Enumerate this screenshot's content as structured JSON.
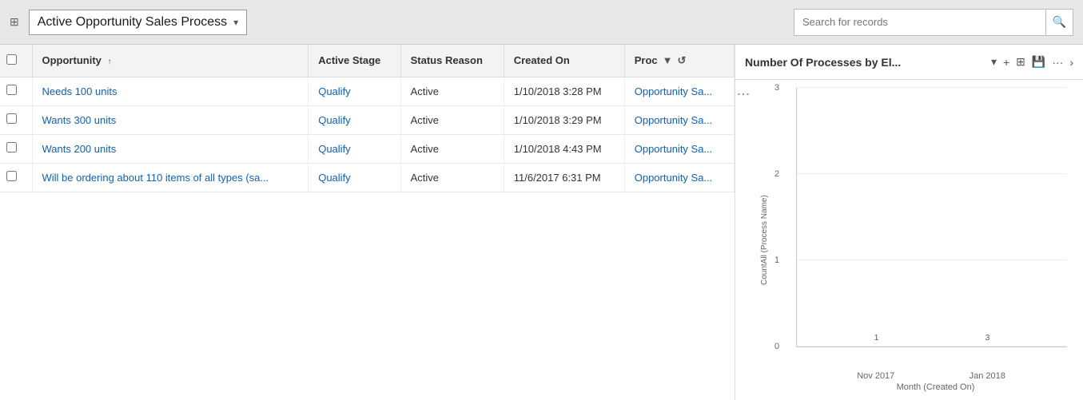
{
  "header": {
    "nav_icon": "⊞",
    "title": "Active Opportunity Sales Process",
    "chevron": "▾",
    "search_placeholder": "Search for records",
    "search_icon": "🔍"
  },
  "table": {
    "columns": [
      {
        "id": "checkbox",
        "label": ""
      },
      {
        "id": "opportunity",
        "label": "Opportunity",
        "sort": "↑"
      },
      {
        "id": "active_stage",
        "label": "Active Stage"
      },
      {
        "id": "status_reason",
        "label": "Status Reason"
      },
      {
        "id": "created_on",
        "label": "Created On"
      },
      {
        "id": "process",
        "label": "Proc"
      }
    ],
    "rows": [
      {
        "opportunity": "Needs 100 units",
        "active_stage": "Qualify",
        "status_reason": "Active",
        "created_on": "1/10/2018 3:28 PM",
        "process": "Opportunity Sa..."
      },
      {
        "opportunity": "Wants 300 units",
        "active_stage": "Qualify",
        "status_reason": "Active",
        "created_on": "1/10/2018 3:29 PM",
        "process": "Opportunity Sa..."
      },
      {
        "opportunity": "Wants 200 units",
        "active_stage": "Qualify",
        "status_reason": "Active",
        "created_on": "1/10/2018 4:43 PM",
        "process": "Opportunity Sa..."
      },
      {
        "opportunity": "Will be ordering about 110 items of all types (sa...",
        "active_stage": "Qualify",
        "status_reason": "Active",
        "created_on": "11/6/2017 6:31 PM",
        "process": "Opportunity Sa..."
      }
    ]
  },
  "chart": {
    "title": "Number Of Processes by El...",
    "chevron": "▾",
    "y_axis_label": "CountAll (Process Name)",
    "x_axis_label": "Month (Created On)",
    "y_ticks": [
      0,
      1,
      2,
      3
    ],
    "bars": [
      {
        "label": "Nov 2017",
        "value": 1,
        "display_value": "1"
      },
      {
        "label": "Jan 2018",
        "value": 3,
        "display_value": "3"
      }
    ],
    "max_value": 3,
    "icons": {
      "add": "+",
      "layout": "⊞",
      "save": "💾",
      "more": "···",
      "expand": "›"
    }
  }
}
